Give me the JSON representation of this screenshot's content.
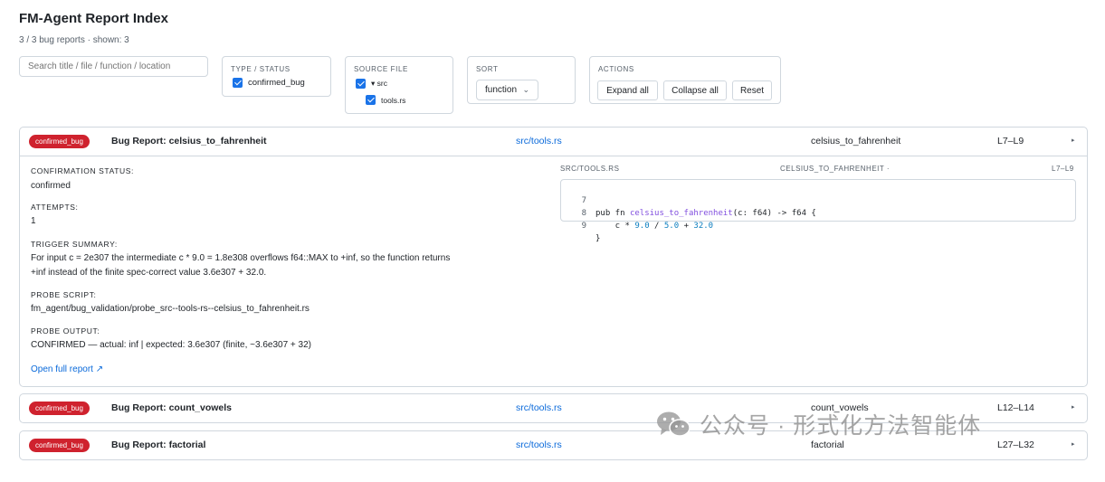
{
  "header": {
    "title": "FM-Agent Report Index",
    "subtitle": "3 / 3 bug reports · shown: 3"
  },
  "search": {
    "placeholder": "Search title / file / function / location"
  },
  "filters": {
    "type_status": {
      "title": "TYPE / STATUS",
      "options": [
        {
          "label": "confirmed_bug",
          "checked": true
        }
      ]
    },
    "source_file": {
      "title": "SOURCE FILE",
      "folder": {
        "label": "▾ src",
        "checked": true
      },
      "files": [
        {
          "label": "tools.rs",
          "checked": true
        }
      ]
    },
    "sort": {
      "title": "SORT",
      "selected": "function"
    },
    "actions": {
      "title": "ACTIONS",
      "expand_all": "Expand all",
      "collapse_all": "Collapse all",
      "reset": "Reset"
    }
  },
  "reports": [
    {
      "badge": "confirmed_bug",
      "title": "Bug Report: celsius_to_fahrenheit",
      "file": "src/tools.rs",
      "function": "celsius_to_fahrenheit",
      "lines": "L7–L9",
      "expanded": true,
      "details": {
        "confirmation_status_label": "CONFIRMATION STATUS:",
        "confirmation_status": "confirmed",
        "attempts_label": "ATTEMPTS:",
        "attempts": "1",
        "trigger_summary_label": "TRIGGER SUMMARY:",
        "trigger_summary_line1": "For input c = 2e307 the intermediate c * 9.0 = 1.8e308 overflows f64::MAX to +inf, so the function returns",
        "trigger_summary_line2": "+inf instead of the finite spec-correct value 3.6e307 + 32.0.",
        "probe_script_label": "PROBE SCRIPT:",
        "probe_script": "fm_agent/bug_validation/probe_src--tools-rs--celsius_to_fahrenheit.rs",
        "probe_output_label": "PROBE OUTPUT:",
        "probe_output": "CONFIRMED — actual: inf | expected: 3.6e307 (finite, ~3.6e307 + 32)",
        "open_full_report": "Open full report ↗"
      },
      "source": {
        "file_header": "SRC/TOOLS.RS",
        "function_header": "CELSIUS_TO_FAHRENHEIT ·",
        "range_header": "L7–L9",
        "lines": [
          {
            "n": "7",
            "pre": "pub fn ",
            "fn": "celsius_to_fahrenheit",
            "post": "(c: f64) -> f64 {"
          },
          {
            "n": "8",
            "pre": "    c * ",
            "num1": "9.0",
            "mid1": " / ",
            "num2": "5.0",
            "mid2": " + ",
            "num3": "32.0"
          },
          {
            "n": "9",
            "pre": "}"
          }
        ]
      }
    },
    {
      "badge": "confirmed_bug",
      "title": "Bug Report: count_vowels",
      "file": "src/tools.rs",
      "function": "count_vowels",
      "lines": "L12–L14",
      "expanded": false
    },
    {
      "badge": "confirmed_bug",
      "title": "Bug Report: factorial",
      "file": "src/tools.rs",
      "function": "factorial",
      "lines": "L27–L32",
      "expanded": false
    }
  ],
  "toggle_glyph": "▸",
  "watermark": "公众号 · 形式化方法智能体"
}
